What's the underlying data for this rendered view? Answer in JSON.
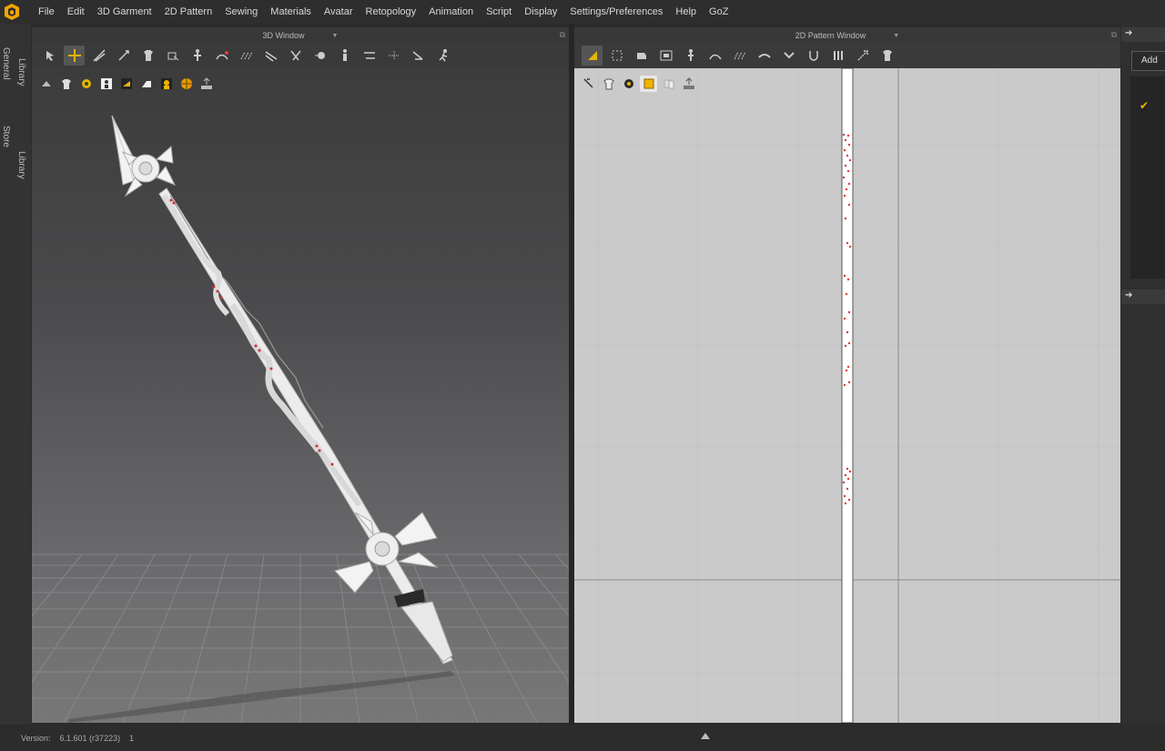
{
  "menu": [
    "File",
    "Edit",
    "3D Garment",
    "2D Pattern",
    "Sewing",
    "Materials",
    "Avatar",
    "Retopology",
    "Animation",
    "Script",
    "Display",
    "Settings/Preferences",
    "Help",
    "GoZ"
  ],
  "left_tabs": {
    "library_general": "Library",
    "general": "General",
    "store": "Store",
    "library2": "Library"
  },
  "window3d": {
    "title": "3D Window"
  },
  "window2d": {
    "title": "2D Pattern Window"
  },
  "right_panel": {
    "add_label": "Add"
  },
  "status": {
    "version_label": "Version:",
    "version_value": "6.1.601 (r37223)",
    "extra": "1"
  },
  "colors": {
    "accent": "#f0b400",
    "seam_red": "#e03a3a",
    "grid_2d": "#cacaca"
  }
}
